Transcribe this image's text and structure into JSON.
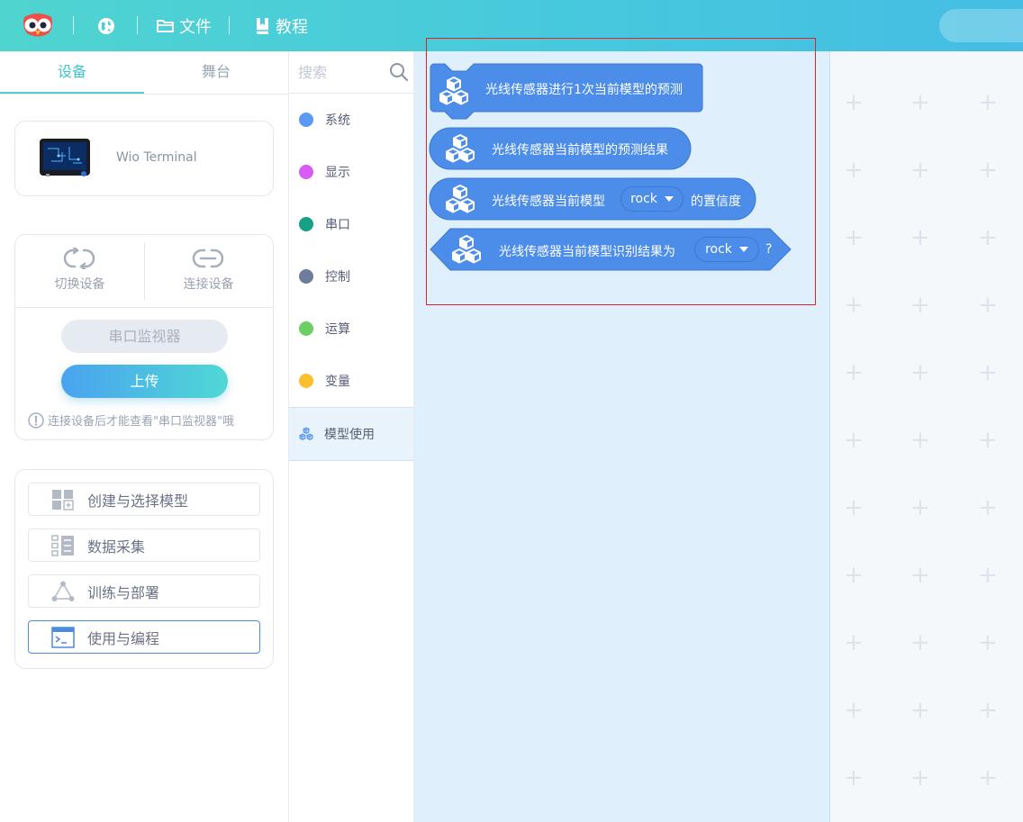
{
  "topbar": {
    "file_label": "文件",
    "tutorial_label": "教程",
    "icons": [
      "owl-logo-icon",
      "globe-icon",
      "folder-icon",
      "book-icon"
    ]
  },
  "left_tabs": {
    "device": "设备",
    "stage": "舞台"
  },
  "device": {
    "name": "Wio Terminal"
  },
  "controls": {
    "switch_device": "切换设备",
    "connect_device": "连接设备",
    "serial_monitor": "串口监视器",
    "upload": "上传",
    "hint": "连接设备后才能查看\"串口监视器\"哦"
  },
  "ml_menu": [
    {
      "label": "创建与选择模型",
      "icon": "model-grid-icon",
      "active": false
    },
    {
      "label": "数据采集",
      "icon": "data-list-icon",
      "active": false
    },
    {
      "label": "训练与部署",
      "icon": "triangle-nodes-icon",
      "active": false
    },
    {
      "label": "使用与编程",
      "icon": "terminal-icon",
      "active": true
    }
  ],
  "search": {
    "placeholder": "搜索"
  },
  "categories": [
    {
      "label": "系统",
      "color": "#5a9af5"
    },
    {
      "label": "显示",
      "color": "#d65cf5"
    },
    {
      "label": "串口",
      "color": "#16a085"
    },
    {
      "label": "控制",
      "color": "#6f7d9c"
    },
    {
      "label": "运算",
      "color": "#6ccf63"
    },
    {
      "label": "变量",
      "color": "#fcbf2e"
    },
    {
      "label": "模型使用",
      "color": "#4c8de9",
      "active": true
    }
  ],
  "blocks": [
    {
      "type": "command",
      "text": "光线传感器进行1次当前模型的预测"
    },
    {
      "type": "reporter",
      "text": "光线传感器当前模型的预测结果"
    },
    {
      "type": "reporter",
      "text_before": "光线传感器当前模型",
      "dropdown": "rock",
      "text_after": "的置信度"
    },
    {
      "type": "boolean",
      "text_before": "光线传感器当前模型识别结果为",
      "dropdown": "rock",
      "text_after": "?"
    }
  ],
  "colors": {
    "block": "#4c8de9",
    "block_border": "#3c78d1",
    "accent": "#3fc4c8",
    "highlight_box": "#e0232b"
  }
}
